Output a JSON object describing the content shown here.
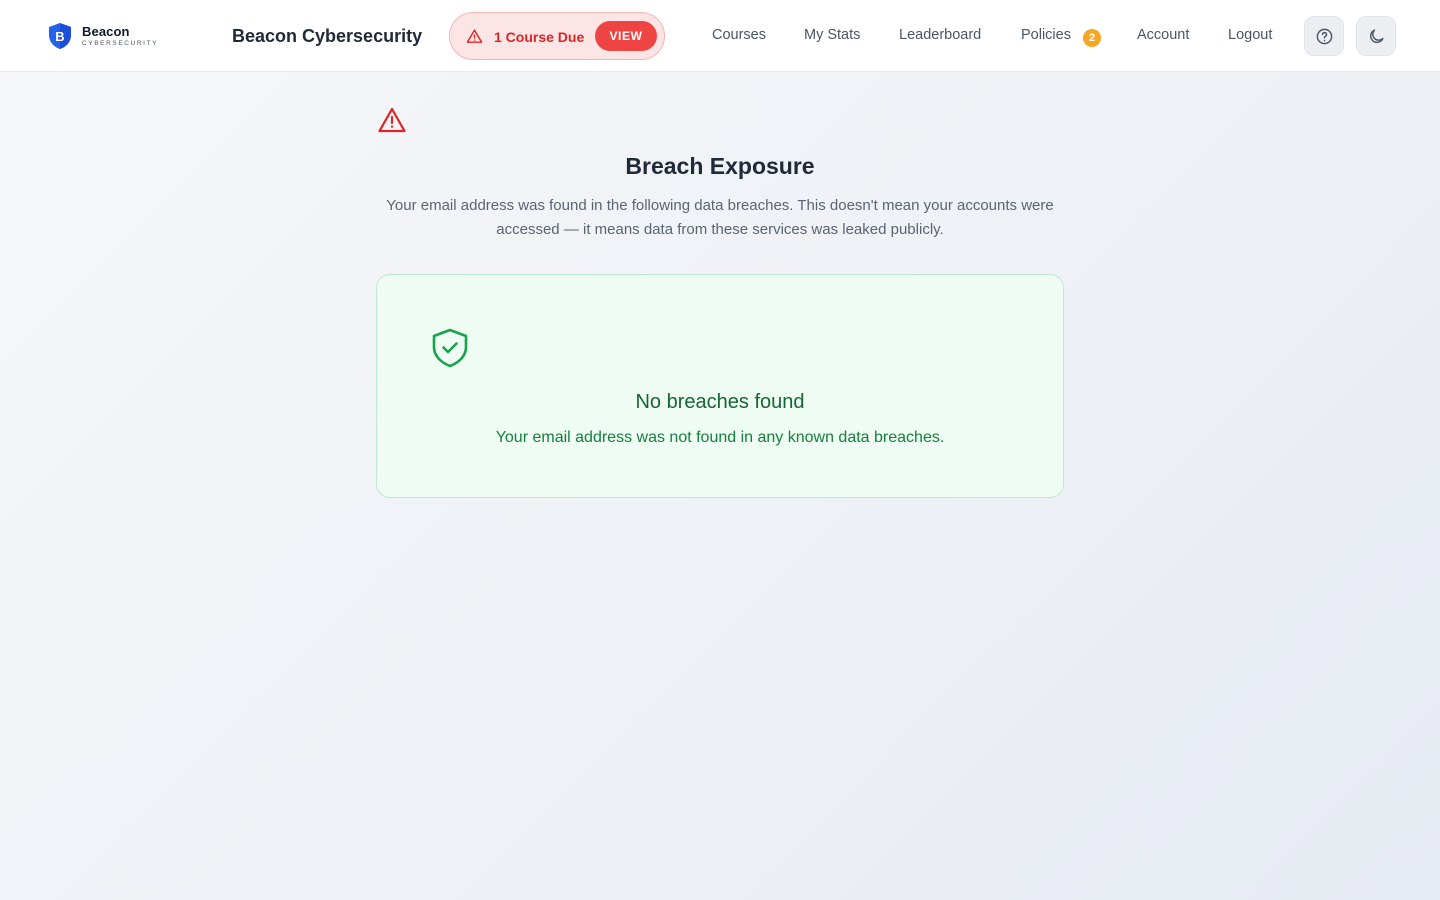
{
  "header": {
    "logo": {
      "name": "Beacon",
      "subtitle": "CYBERSECURITY",
      "initial": "B",
      "icon": "shield-b-icon"
    },
    "brand_title": "Beacon Cybersecurity",
    "due_alert": {
      "icon": "warning-icon",
      "text": "1 Course Due",
      "button_label": "VIEW"
    },
    "nav": {
      "courses": "Courses",
      "my_stats": "My Stats",
      "leaderboard": "Leaderboard",
      "policies": "Policies",
      "policies_badge": "2",
      "account": "Account",
      "logout": "Logout"
    },
    "help_icon": "help-circle-icon",
    "theme_icon": "moon-icon"
  },
  "main": {
    "alert_icon": "warning-triangle-icon",
    "title": "Breach Exposure",
    "description": "Your email address was found in the following data breaches. This doesn't mean your accounts were accessed — it means data from these services was leaked publicly.",
    "result": {
      "icon": "shield-check-icon",
      "title": "No breaches found",
      "text": "Your email address was not found in any known data breaches."
    }
  },
  "colors": {
    "brand_blue": "#2563eb",
    "alert_red": "#dc2626",
    "view_button": "#ef4444",
    "badge_orange": "#f5a623",
    "success_green": "#16a34a",
    "success_bg": "#effcf3"
  }
}
